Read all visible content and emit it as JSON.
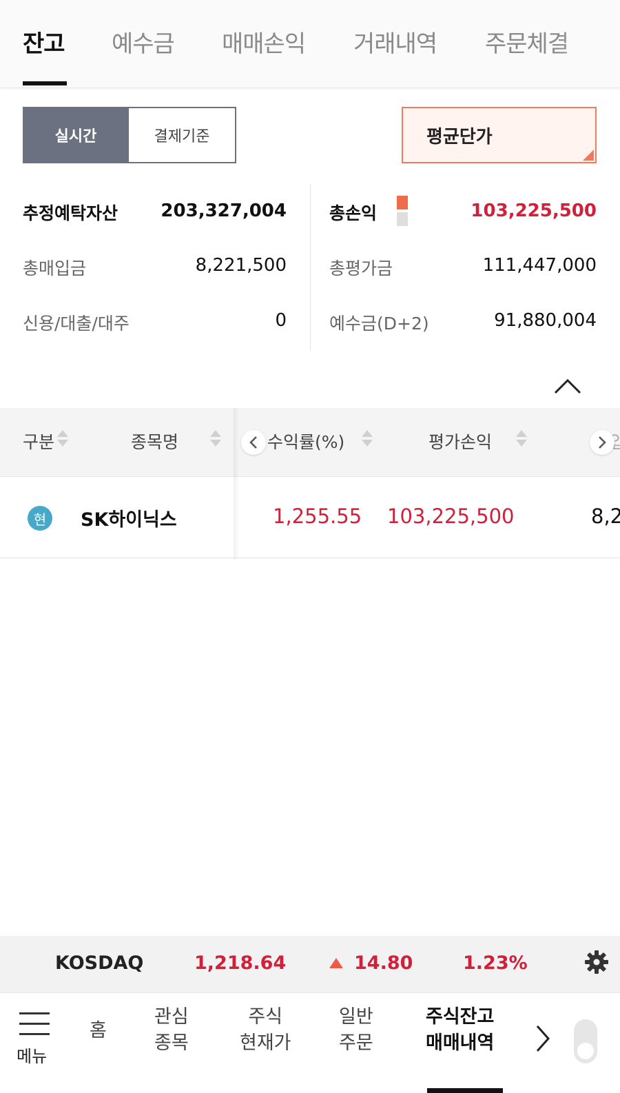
{
  "tabs": [
    "잔고",
    "예수금",
    "매매손익",
    "거래내역",
    "주문체결"
  ],
  "toggle": {
    "realtime": "실시간",
    "settlement": "결제기준"
  },
  "avg_price_button": "평균단가",
  "summary": {
    "est_deposit_assets_label": "추정예탁자산",
    "est_deposit_assets_value": "203,327,004",
    "total_buy_label": "총매입금",
    "total_buy_value": "8,221,500",
    "credit_label": "신용/대출/대주",
    "credit_value": "0",
    "total_pnl_label": "총손익",
    "total_pnl_value": "103,225,500",
    "total_eval_label": "총평가금",
    "total_eval_value": "111,447,000",
    "deposit_d2_label": "예수금(D+2)",
    "deposit_d2_value": "91,880,004"
  },
  "table": {
    "headers": {
      "category": "구분",
      "name": "종목명",
      "return_rate": "수익률(%)",
      "eval_pnl": "평가손익",
      "partial": "매입"
    },
    "rows": [
      {
        "badge": "현",
        "name": "SK하이닉스",
        "return_rate": "1,255.55",
        "eval_pnl": "103,225,500",
        "partial": "8,2"
      }
    ]
  },
  "ticker": {
    "index": "KOSDAQ",
    "value": "1,218.64",
    "change": "14.80",
    "change_pct": "1.23%"
  },
  "bottom_nav": {
    "menu": "메뉴",
    "home": "홈",
    "watchlist_1": "관심",
    "watchlist_2": "종목",
    "stock_price_1": "주식",
    "stock_price_2": "현재가",
    "order_1": "일반",
    "order_2": "주문",
    "active_1": "주식잔고",
    "active_2": "매매내역"
  },
  "colors": {
    "accent_red": "#d21f3a",
    "toggle_active": "#6b7180",
    "avg_border": "#f07a5e",
    "badge": "#46a9c9"
  }
}
